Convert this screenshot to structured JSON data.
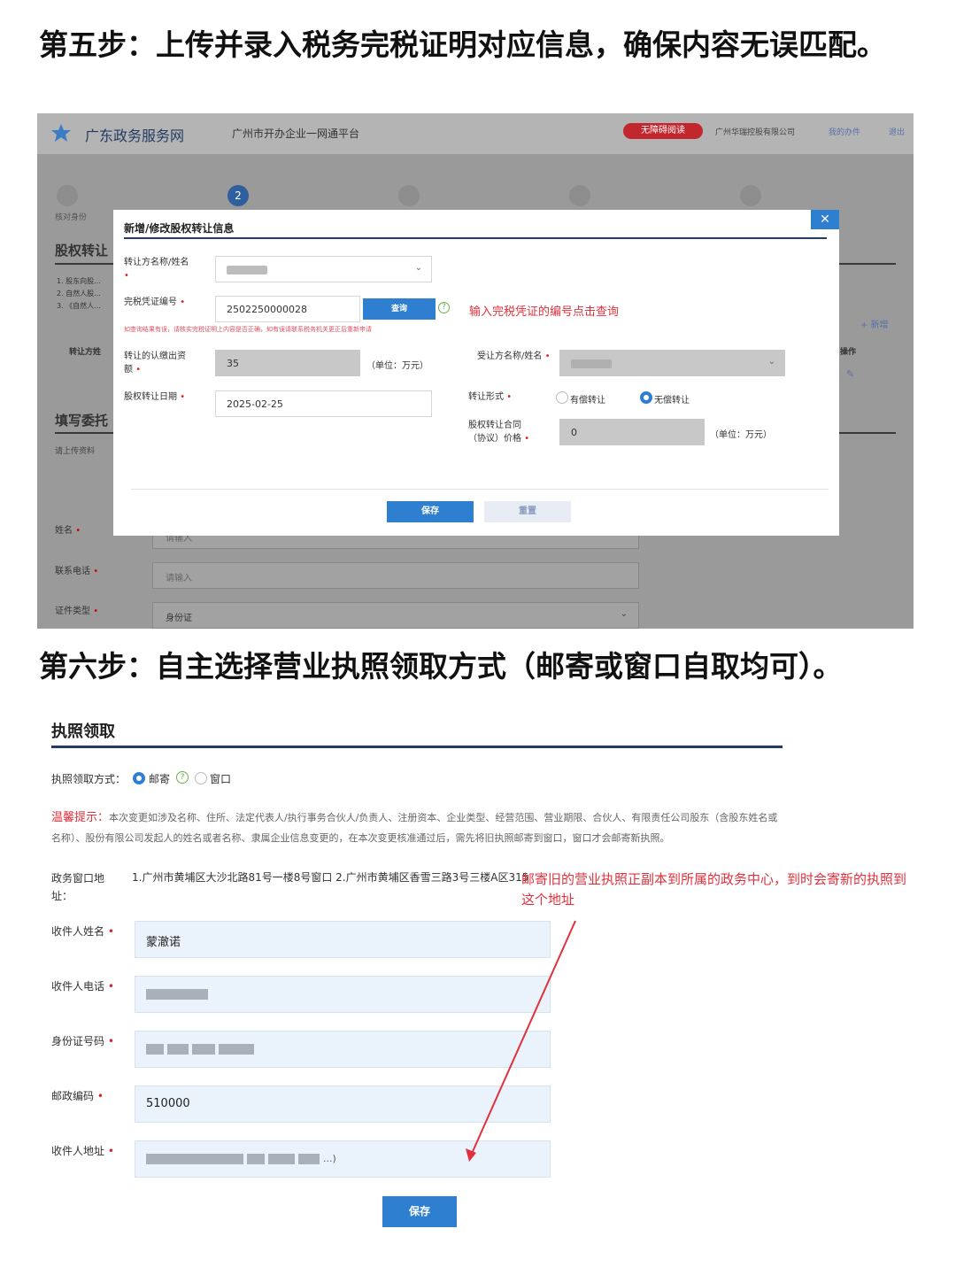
{
  "step5_heading": "第五步：上传并录入税务完税证明对应信息，确保内容无误匹配。",
  "step6_heading": "第六步：自主选择营业执照领取方式（邮寄或窗口自取均可）。",
  "colors": {
    "accent_blue": "#2f7fd0",
    "navy": "#243b63",
    "annotation_red": "#e0313d"
  },
  "portal": {
    "site_name": "广东政务服务网",
    "platform": "广州市开办企业一网通平台",
    "accessibility_button": "无障碍阅读",
    "company": "广州华瑞控股有限公司",
    "my_tasks": "我的办件",
    "logout": "退出",
    "current_step": "2",
    "step1_label": "核对身份",
    "background": {
      "section_title": "股权转让",
      "list_items": [
        "1. 股东向股...",
        "2. 自然人股...",
        "3. 《自然人..."
      ],
      "transferor_col": "转让方姓",
      "add_button": "+ 新增",
      "op_col": "操作",
      "edit_icon": "✎",
      "fill_title": "填写委托",
      "upload_hint": "请上传资料",
      "name_label": "姓名",
      "name_placeholder": "请输入",
      "phone_label": "联系电话",
      "phone_placeholder": "请输入",
      "id_type_label": "证件类型",
      "id_type_value": "身份证"
    }
  },
  "modal": {
    "title": "新增/修改股权转让信息",
    "close_icon": "✕",
    "transferor_label": "转让方名称/姓名",
    "cert_label": "完税凭证编号",
    "cert_value": "2502250000028",
    "query_button": "查询",
    "query_help_icon": "?",
    "annotation": "输入完税凭证的编号点击查询",
    "warning": "如查询结果有误，请核实完税证明上内容是否正确，如有误请联系税务机关更正后重新申请",
    "capital_label": "转让的认缴出资额",
    "capital_value": "35",
    "unit": "（单位：万元）",
    "transferee_label": "受让方名称/姓名",
    "date_label": "股权转让日期",
    "date_value": "2025-02-25",
    "form_label": "转让形式",
    "form_options": [
      "有偿转让",
      "无偿转让"
    ],
    "form_selected": "无偿转让",
    "price_label": "股权转让合同（协议）价格",
    "price_value": "0",
    "save_button": "保存",
    "reset_button": "重置"
  },
  "license": {
    "title": "执照领取",
    "method_label": "执照领取方式：",
    "options": [
      "邮寄",
      "窗口"
    ],
    "selected": "邮寄",
    "method_help_icon": "?",
    "tip_label": "温馨提示：",
    "tip_text": "本次变更如涉及名称、住所、法定代表人/执行事务合伙人/负责人、注册资本、企业类型、经营范围、营业期限、合伙人、有限责任公司股东（含股东姓名或名称）、股份有限公司发起人的姓名或者名称、隶属企业信息变更的，在本次变更核准通过后，需先将旧执照邮寄到窗口，窗口才会邮寄新执照。",
    "window_addr_label": "政务窗口地址：",
    "window_addr_value": "1.广州市黄埔区大沙北路81号一楼8号窗口 2.广州市黄埔区香雪三路3号三楼A区315",
    "annotation": "邮寄旧的营业执照正副本到所属的政务中心，到时会寄新的执照到这个地址",
    "recipient_name_label": "收件人姓名",
    "recipient_name_value": "蒙澈诺",
    "recipient_phone_label": "收件人电话",
    "id_number_label": "身份证号码",
    "postcode_label": "邮政编码",
    "postcode_value": "510000",
    "address_label": "收件人地址",
    "address_tail": "...)",
    "save_button": "保存"
  }
}
